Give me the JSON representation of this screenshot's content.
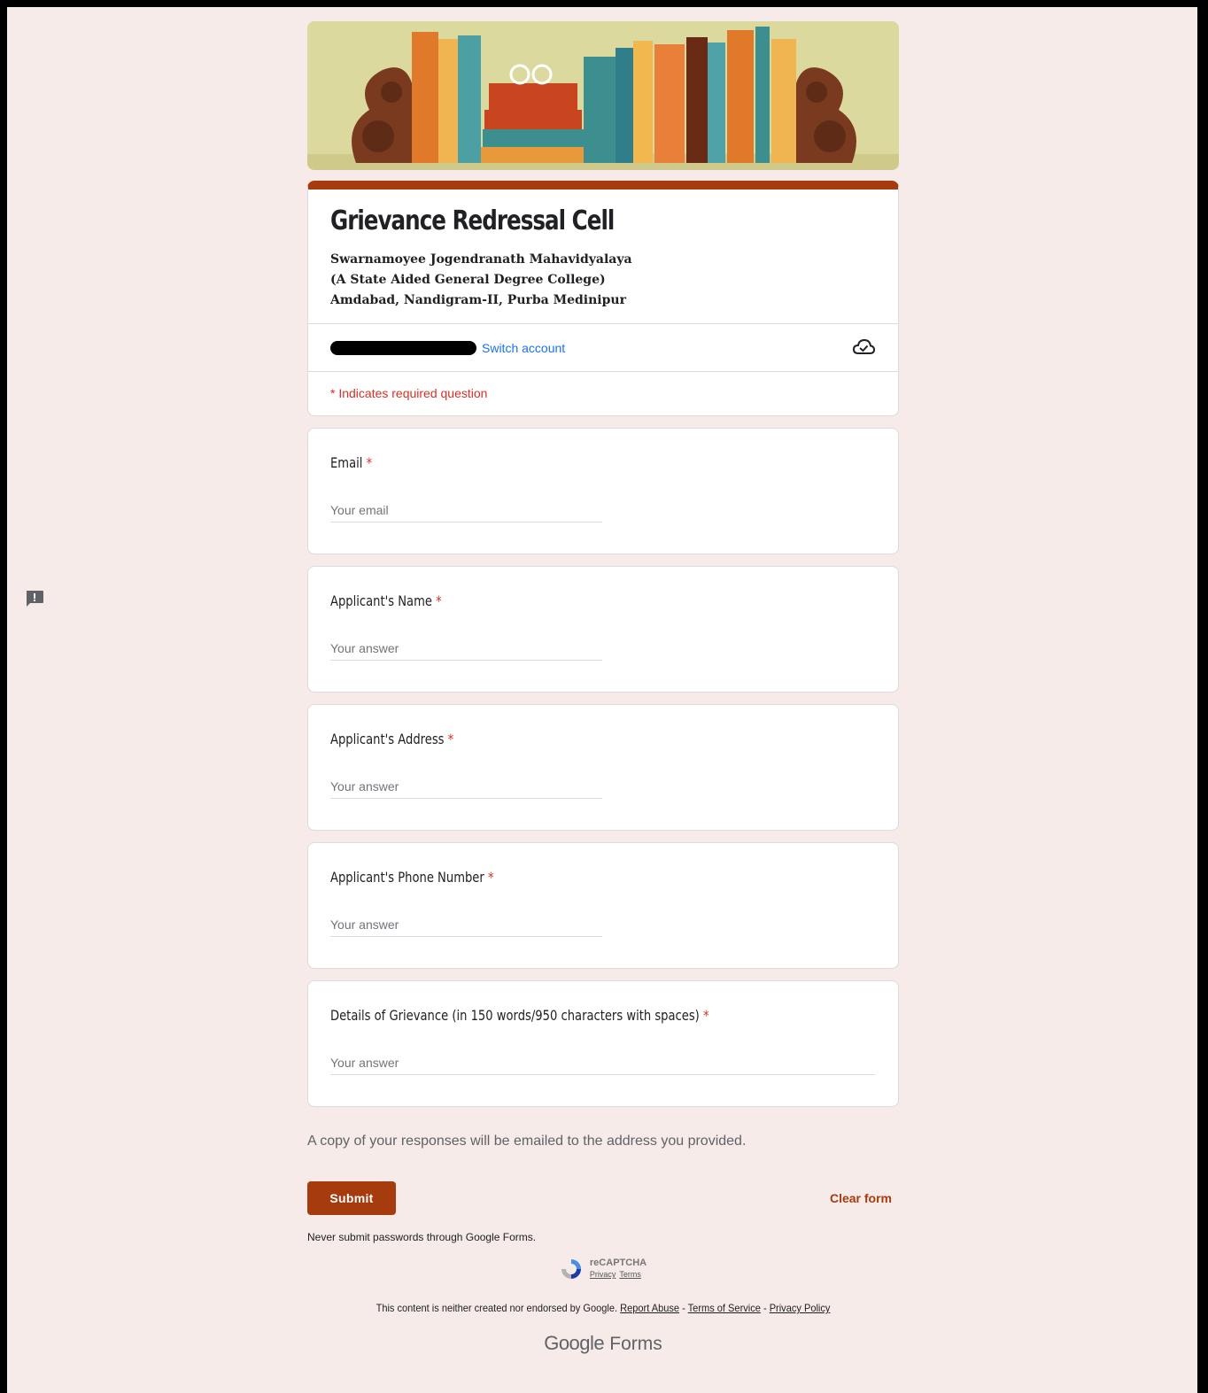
{
  "form": {
    "title": "Grievance Redressal Cell",
    "description_lines": [
      "Swarnamoyee Jogendranath Mahavidyalaya",
      "(A State Aided General Degree College)",
      "Amdabad, Nandigram-II, Purba Medinipur"
    ],
    "accent_color": "#a63b0e",
    "background_color": "#f6ebe8"
  },
  "account": {
    "switch_label": "Switch account",
    "save_status_icon": "cloud-check-icon"
  },
  "required_note": "* Indicates required question",
  "questions": [
    {
      "label": "Email",
      "required_mark": "*",
      "placeholder": "Your email"
    },
    {
      "label": "Applicant's Name",
      "required_mark": "*",
      "placeholder": "Your answer"
    },
    {
      "label": "Applicant's Address",
      "required_mark": "*",
      "placeholder": "Your answer"
    },
    {
      "label": "Applicant's Phone Number",
      "required_mark": "*",
      "placeholder": "Your answer"
    },
    {
      "label": "Details of Grievance (in 150 words/950 characters with spaces)",
      "required_mark": "*",
      "placeholder": "Your answer"
    }
  ],
  "copy_note": "A copy of your responses will be emailed to the address you provided.",
  "actions": {
    "submit_label": "Submit",
    "clear_label": "Clear form"
  },
  "password_note": "Never submit passwords through Google Forms.",
  "recaptcha": {
    "name": "reCAPTCHA",
    "privacy": "Privacy",
    "terms": "Terms"
  },
  "footer": {
    "disclaimer": "This content is neither created nor endorsed by Google.",
    "report_abuse": "Report Abuse",
    "terms_of_service": "Terms of Service",
    "privacy_policy": "Privacy Policy",
    "separator": " - ",
    "brand_google": "Google",
    "brand_forms": "Forms"
  }
}
